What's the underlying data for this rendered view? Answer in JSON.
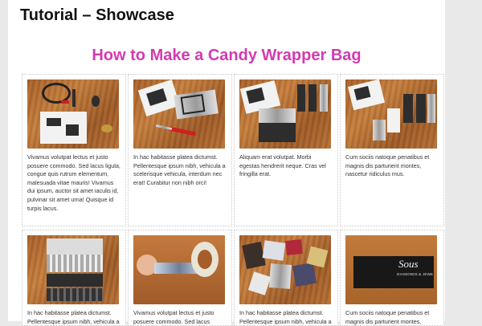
{
  "page": {
    "title": "Tutorial – Showcase"
  },
  "article": {
    "title": "How to Make a Candy Wrapper Bag"
  },
  "cards": [
    {
      "photo_icon": "tools-on-table-photo",
      "caption": "Vivamus volutpat lectus et justo posuere commodo. Sed lacus ligula, congue quis rutrum elementum, malesuada vitae mauris! Vivamus dui ipsum, auctor sit amet iaculis id, pulvinar sit amet urna! Quisque id turpis lacus."
    },
    {
      "photo_icon": "wrapper-and-scissors-photo",
      "caption": "In hac habitasse platea dictumst. Pellentesque ipsum nibh, vehicula a scelerisque vehicula, interdum nec erat! Curabitur non nibh orci!"
    },
    {
      "photo_icon": "cut-wrapper-strips-photo",
      "caption": "Aliquam erat volutpat. Morbi egestas hendrerit neque. Cras vel fringilla erat."
    },
    {
      "photo_icon": "folded-wrapper-strips-photo",
      "caption": "Cum sociis natoque penatibus et magnis dis parturient montes, nascetur ridiculus mus."
    },
    {
      "photo_icon": "stacked-strips-photo",
      "caption": "In hac habitasse platea dictumst. Pellentesque ipsum nibh, vehicula a"
    },
    {
      "photo_icon": "taping-wrapper-photo",
      "caption": "Vivamus volutpat lectus et justo posuere commodo. Sed lacus"
    },
    {
      "photo_icon": "pile-of-wrappers-photo",
      "caption": "In hac habitasse platea dictumst. Pellentesque ipsum nibh, vehicula a"
    },
    {
      "photo_icon": "finished-bag-photo",
      "caption": "Cum sociis natoque penatibus et magnis dis parturient montes,"
    }
  ],
  "logo_text": {
    "brand": "Sous",
    "sub": "DIAMONDS & JEWE"
  }
}
